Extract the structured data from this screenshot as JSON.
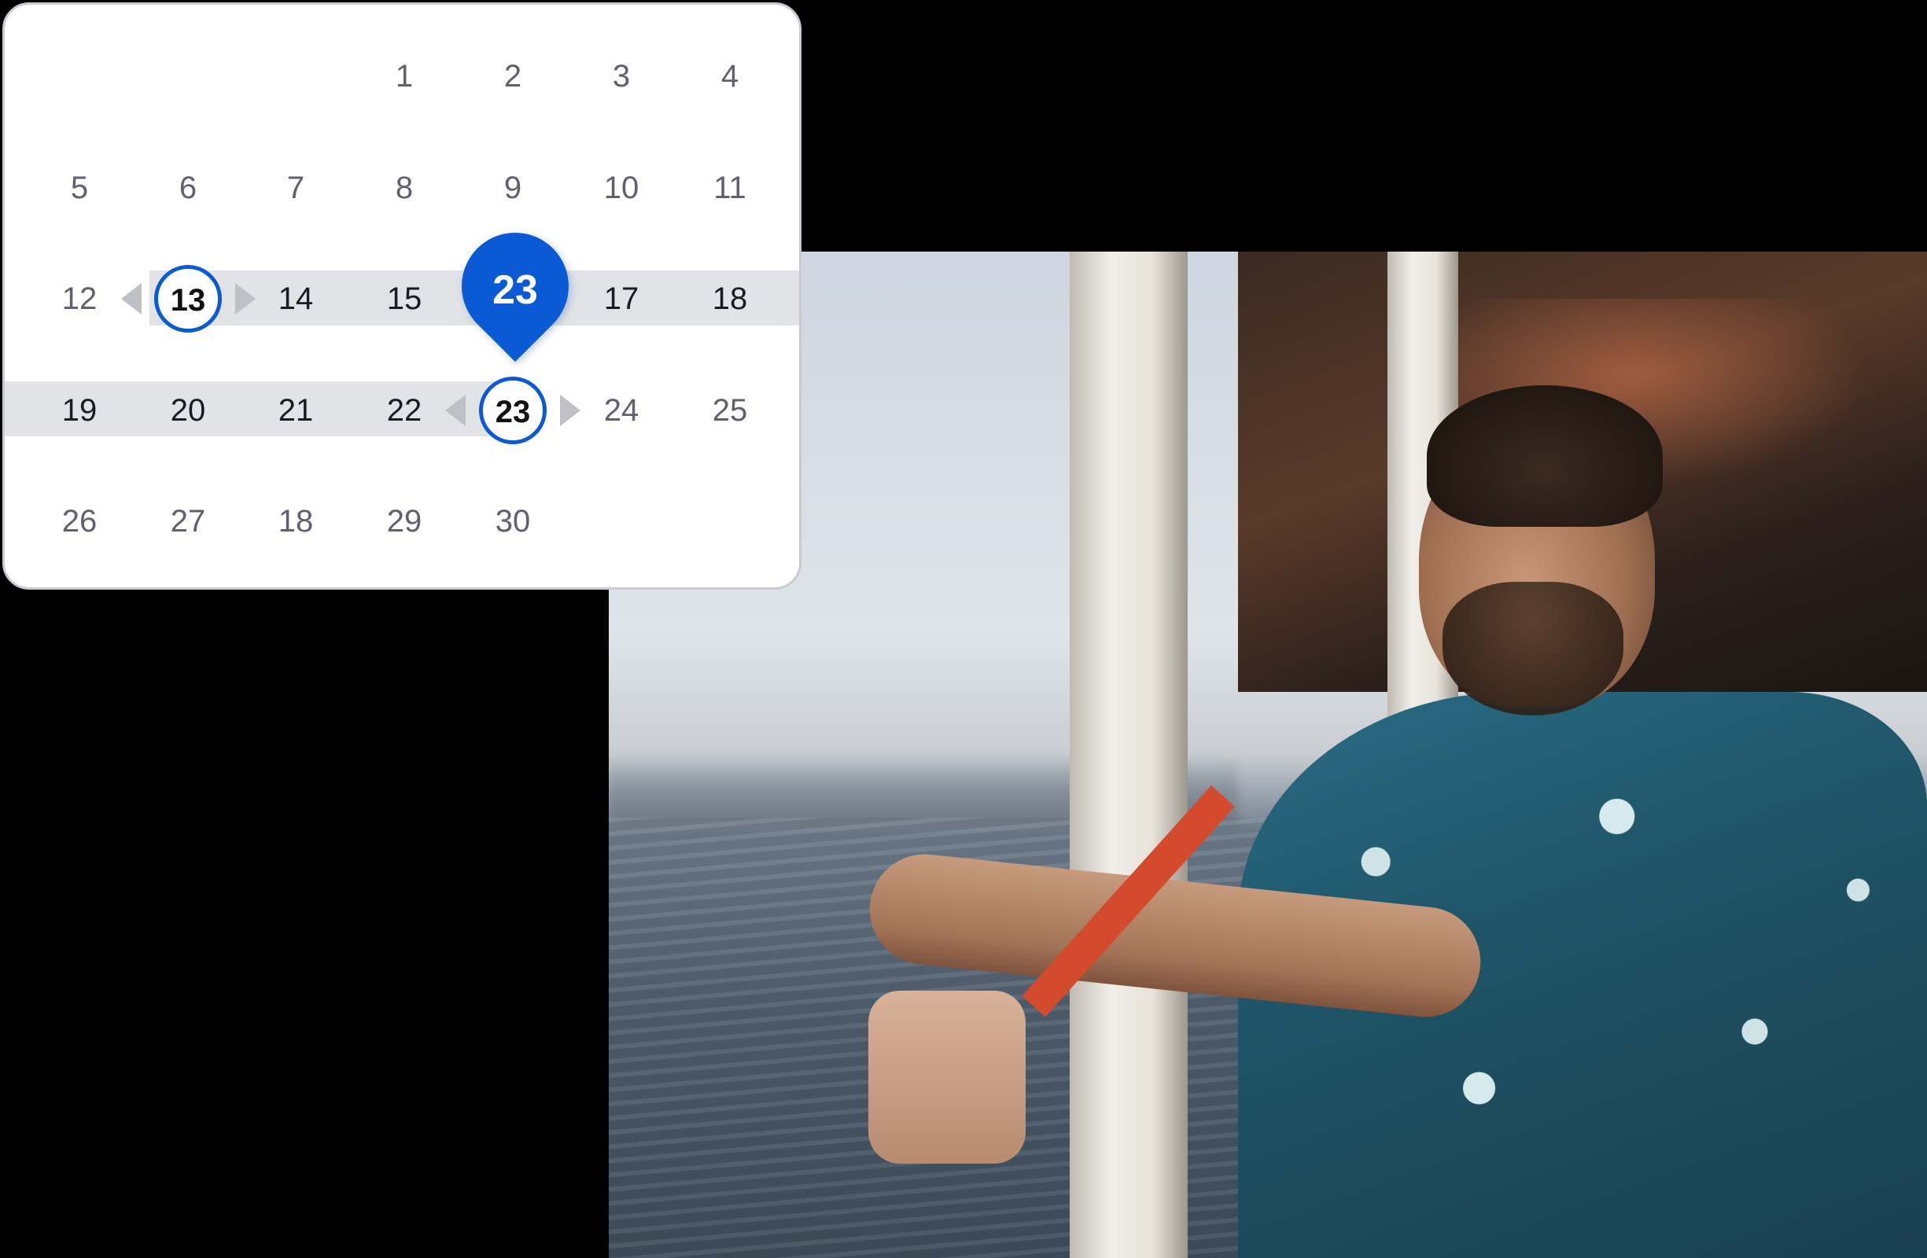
{
  "calendar": {
    "weeks": [
      [
        "",
        "",
        "",
        "1",
        "2",
        "3",
        "4"
      ],
      [
        "5",
        "6",
        "7",
        "8",
        "9",
        "10",
        "11"
      ],
      [
        "12",
        "13",
        "14",
        "15",
        "",
        "17",
        "18"
      ],
      [
        "19",
        "20",
        "21",
        "22",
        "23",
        "24",
        "25"
      ],
      [
        "26",
        "27",
        "18",
        "29",
        "30",
        "",
        ""
      ]
    ],
    "range_start": "13",
    "range_end": "23",
    "pin_label": "23",
    "accent_color": "#0a5ad6",
    "range_color": "#e2e3e7"
  },
  "photo": {
    "subject": "man-on-ferry"
  }
}
